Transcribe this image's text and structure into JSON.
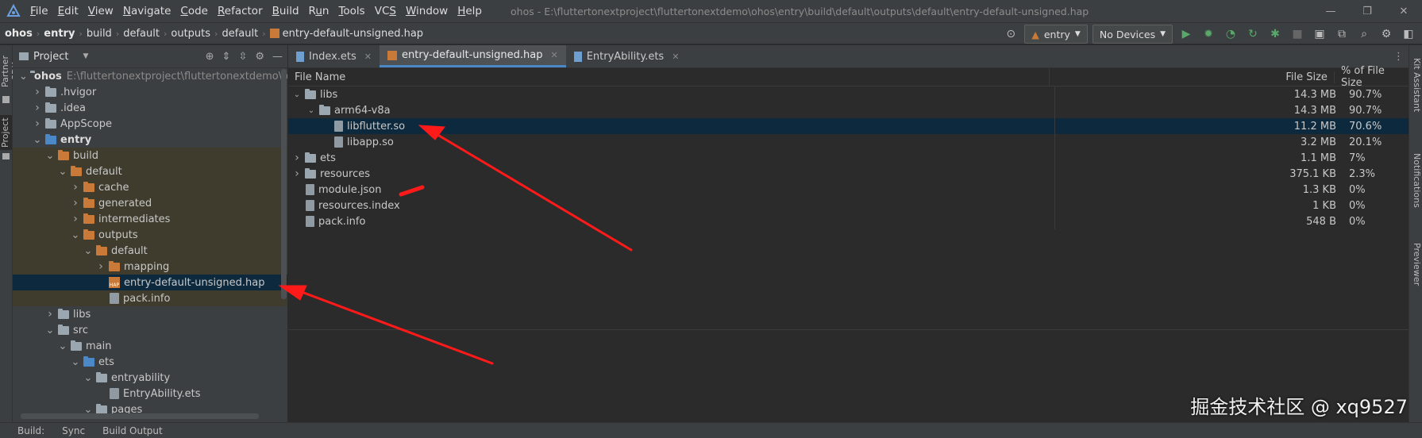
{
  "menubar": {
    "items": [
      "File",
      "Edit",
      "View",
      "Navigate",
      "Code",
      "Refactor",
      "Build",
      "Run",
      "Tools",
      "VCS",
      "Window",
      "Help"
    ],
    "underline": [
      "F",
      "E",
      "V",
      "N",
      "C",
      "R",
      "B",
      "u",
      "T",
      "S",
      "W",
      "H"
    ],
    "window_title": "ohos - E:\\fluttertonextproject\\fluttertonextdemo\\ohos\\entry\\build\\default\\outputs\\default\\entry-default-unsigned.hap",
    "logo_icon": "deveco-logo-icon"
  },
  "breadcrumbs": [
    "ohos",
    "entry",
    "build",
    "default",
    "outputs",
    "default",
    "entry-default-unsigned.hap"
  ],
  "runconfig": {
    "module": "entry",
    "device": "No Devices"
  },
  "left_strip": {
    "partner_sdk": "Partner SDK",
    "project": "Project"
  },
  "right_strip": {
    "kit_assistant": "Kit Assistant",
    "notifications": "Notifications",
    "previewer": "Previewer"
  },
  "project_panel": {
    "title": "Project",
    "tree": [
      {
        "label": "ohos",
        "indent": 0,
        "arrow": "down",
        "icon": "folder-gray",
        "bold": true,
        "path": "E:\\fluttertonextproject\\fluttertonextdemo\\ohos"
      },
      {
        "label": ".hvigor",
        "indent": 1,
        "arrow": "right",
        "icon": "folder-gray"
      },
      {
        "label": ".idea",
        "indent": 1,
        "arrow": "right",
        "icon": "folder-gray"
      },
      {
        "label": "AppScope",
        "indent": 1,
        "arrow": "right",
        "icon": "folder-gray"
      },
      {
        "label": "entry",
        "indent": 1,
        "arrow": "down",
        "icon": "folder-blue",
        "bold": true
      },
      {
        "label": "build",
        "indent": 2,
        "arrow": "down",
        "icon": "folder-orange",
        "hl": "build"
      },
      {
        "label": "default",
        "indent": 3,
        "arrow": "down",
        "icon": "folder-orange",
        "hl": "build"
      },
      {
        "label": "cache",
        "indent": 4,
        "arrow": "right",
        "icon": "folder-orange",
        "hl": "build"
      },
      {
        "label": "generated",
        "indent": 4,
        "arrow": "right",
        "icon": "folder-orange",
        "hl": "build"
      },
      {
        "label": "intermediates",
        "indent": 4,
        "arrow": "right",
        "icon": "folder-orange",
        "hl": "build"
      },
      {
        "label": "outputs",
        "indent": 4,
        "arrow": "down",
        "icon": "folder-orange",
        "hl": "build"
      },
      {
        "label": "default",
        "indent": 5,
        "arrow": "down",
        "icon": "folder-orange",
        "hl": "build"
      },
      {
        "label": "mapping",
        "indent": 6,
        "arrow": "right",
        "icon": "folder-orange",
        "hl": "build"
      },
      {
        "label": "entry-default-unsigned.hap",
        "indent": 6,
        "arrow": "",
        "icon": "hap",
        "hl": "sel"
      },
      {
        "label": "pack.info",
        "indent": 6,
        "arrow": "",
        "icon": "file",
        "hl": "build"
      },
      {
        "label": "libs",
        "indent": 2,
        "arrow": "right",
        "icon": "folder-gray"
      },
      {
        "label": "src",
        "indent": 2,
        "arrow": "down",
        "icon": "folder-gray"
      },
      {
        "label": "main",
        "indent": 3,
        "arrow": "down",
        "icon": "folder-gray"
      },
      {
        "label": "ets",
        "indent": 4,
        "arrow": "down",
        "icon": "folder-blue"
      },
      {
        "label": "entryability",
        "indent": 5,
        "arrow": "down",
        "icon": "folder-gray"
      },
      {
        "label": "EntryAbility.ets",
        "indent": 6,
        "arrow": "",
        "icon": "file"
      },
      {
        "label": "pages",
        "indent": 5,
        "arrow": "down",
        "icon": "folder-gray"
      },
      {
        "label": "Index.ets",
        "indent": 6,
        "arrow": "",
        "icon": "file"
      }
    ]
  },
  "tabs": [
    {
      "label": "Index.ets",
      "icon": "ets-file-icon",
      "active": false
    },
    {
      "label": "entry-default-unsigned.hap",
      "icon": "hap-file-icon",
      "active": true
    },
    {
      "label": "EntryAbility.ets",
      "icon": "ets-file-icon",
      "active": false
    }
  ],
  "hap_table": {
    "columns": [
      "File Name",
      "File Size",
      "% of File Size"
    ],
    "rows": [
      {
        "name": "libs",
        "size": "14.3 MB",
        "pct": "90.7%",
        "indent": 0,
        "arrow": "down",
        "icon": "folder"
      },
      {
        "name": "arm64-v8a",
        "size": "14.3 MB",
        "pct": "90.7%",
        "indent": 1,
        "arrow": "down",
        "icon": "folder"
      },
      {
        "name": "libflutter.so",
        "size": "11.2 MB",
        "pct": "70.6%",
        "indent": 2,
        "arrow": "",
        "icon": "file",
        "selected": true
      },
      {
        "name": "libapp.so",
        "size": "3.2 MB",
        "pct": "20.1%",
        "indent": 2,
        "arrow": "",
        "icon": "file"
      },
      {
        "name": "ets",
        "size": "1.1 MB",
        "pct": "7%",
        "indent": 0,
        "arrow": "right",
        "icon": "folder"
      },
      {
        "name": "resources",
        "size": "375.1 KB",
        "pct": "2.3%",
        "indent": 0,
        "arrow": "right",
        "icon": "folder"
      },
      {
        "name": "module.json",
        "size": "1.3 KB",
        "pct": "0%",
        "indent": 0,
        "arrow": "",
        "icon": "file"
      },
      {
        "name": "resources.index",
        "size": "1 KB",
        "pct": "0%",
        "indent": 0,
        "arrow": "",
        "icon": "file"
      },
      {
        "name": "pack.info",
        "size": "548 B",
        "pct": "0%",
        "indent": 0,
        "arrow": "",
        "icon": "file"
      }
    ]
  },
  "statusbar": [
    "Build:",
    "Sync",
    "Build Output"
  ],
  "watermark": "掘金技术社区 @ xq9527",
  "colors": {
    "accent": "#4a88c7",
    "selection": "#0d293e",
    "build_highlight": "#3f3b2d",
    "annotation_arrow": "#ff1a1a"
  }
}
